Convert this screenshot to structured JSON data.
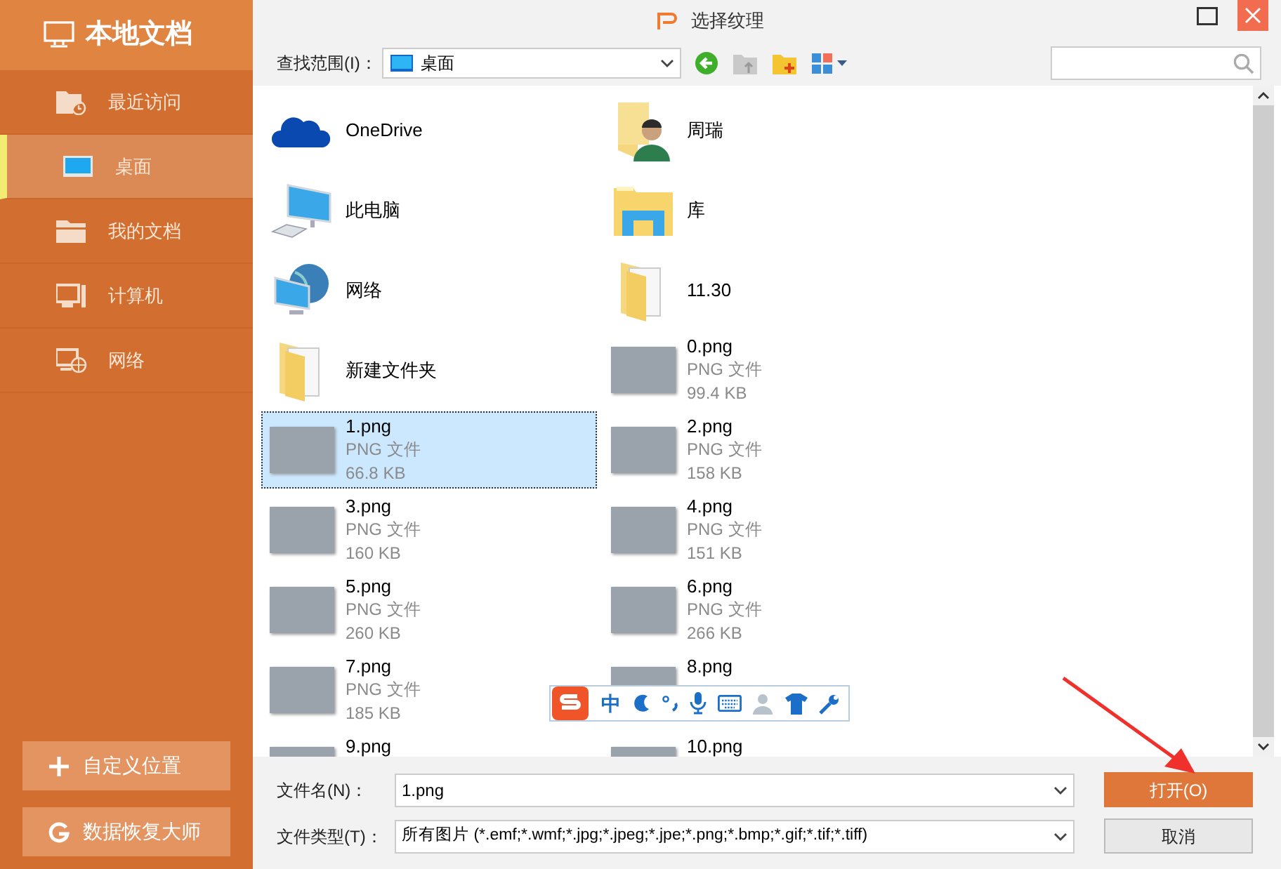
{
  "sidebar": {
    "title": "本地文档",
    "items": [
      {
        "kind": "recent",
        "label": "最近访问",
        "selected": false
      },
      {
        "kind": "desktop",
        "label": "桌面",
        "selected": true
      },
      {
        "kind": "documents",
        "label": "我的文档",
        "selected": false
      },
      {
        "kind": "computer",
        "label": "计算机",
        "selected": false
      },
      {
        "kind": "network",
        "label": "网络",
        "selected": false
      }
    ],
    "buttons": [
      {
        "kind": "add",
        "label": "自定义位置"
      },
      {
        "kind": "recover",
        "label": "数据恢复大师"
      }
    ]
  },
  "window": {
    "title": "选择纹理"
  },
  "toolbar": {
    "label": "查找范围(I)：",
    "location": "桌面"
  },
  "files": [
    {
      "kind": "cloud",
      "name": "OneDrive",
      "selected": false
    },
    {
      "kind": "computer",
      "name": "此电脑",
      "selected": false
    },
    {
      "kind": "network",
      "name": "网络",
      "selected": false
    },
    {
      "kind": "folder",
      "name": "新建文件夹",
      "selected": false
    },
    {
      "kind": "image",
      "name": "1.png",
      "type": "PNG 文件",
      "size": "66.8 KB",
      "selected": true
    },
    {
      "kind": "image",
      "name": "3.png",
      "type": "PNG 文件",
      "size": "160 KB",
      "selected": false
    },
    {
      "kind": "image",
      "name": "5.png",
      "type": "PNG 文件",
      "size": "260 KB",
      "selected": false
    },
    {
      "kind": "image",
      "name": "7.png",
      "type": "PNG 文件",
      "size": "185 KB",
      "selected": false
    },
    {
      "kind": "image",
      "name": "9.png",
      "selected": false
    },
    {
      "kind": "user",
      "name": "周瑞",
      "selected": false
    },
    {
      "kind": "library",
      "name": "库",
      "selected": false
    },
    {
      "kind": "folder",
      "name": "11.30",
      "selected": false
    },
    {
      "kind": "image",
      "name": "0.png",
      "type": "PNG 文件",
      "size": "99.4 KB",
      "selected": false
    },
    {
      "kind": "image",
      "name": "2.png",
      "type": "PNG 文件",
      "size": "158 KB",
      "selected": false
    },
    {
      "kind": "image",
      "name": "4.png",
      "type": "PNG 文件",
      "size": "151 KB",
      "selected": false
    },
    {
      "kind": "image",
      "name": "6.png",
      "type": "PNG 文件",
      "size": "266 KB",
      "selected": false
    },
    {
      "kind": "image",
      "name": "8.png",
      "selected": false
    },
    {
      "kind": "image",
      "name": "10.png",
      "selected": false
    }
  ],
  "footer": {
    "filename_label": "文件名(N)：",
    "filename": "1.png",
    "filetype_label": "文件类型(T)：",
    "filetype": "所有图片 (*.emf;*.wmf;*.jpg;*.jpeg;*.jpe;*.png;*.bmp;*.gif;*.tif;*.tiff)",
    "buttons": [
      {
        "kind": "primary",
        "label": "打开(O)"
      },
      {
        "kind": "secondary",
        "label": "取消"
      }
    ]
  },
  "ime_bar": {
    "mode": "中"
  }
}
